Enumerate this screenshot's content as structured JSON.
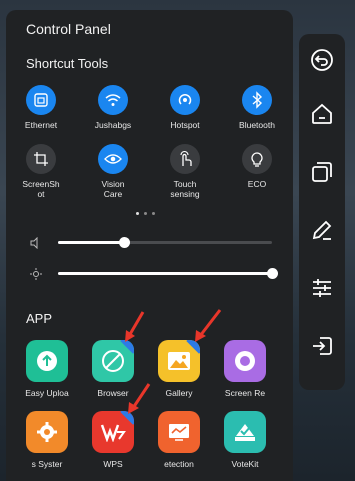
{
  "panel": {
    "title": "Control Panel",
    "shortcut_title": "Shortcut Tools",
    "app_title": "APP"
  },
  "tools": [
    {
      "label": "Ethernet",
      "icon": "ethernet-icon",
      "state": "on"
    },
    {
      "label": "Jushabgs",
      "icon": "wifi-icon",
      "state": "on"
    },
    {
      "label": "Hotspot",
      "icon": "hotspot-icon",
      "state": "on"
    },
    {
      "label": "Bluetooth",
      "icon": "bluetooth-icon",
      "state": "on"
    },
    {
      "label": "ScreenSh\not",
      "icon": "screenshot-crop-icon",
      "state": "off"
    },
    {
      "label": "Vision\nCare",
      "icon": "eye-icon",
      "state": "on"
    },
    {
      "label": "Touch\nsensing",
      "icon": "touch-hand-icon",
      "state": "off"
    },
    {
      "label": "ECO",
      "icon": "bulb-icon",
      "state": "off"
    }
  ],
  "pager": {
    "count": 3,
    "active": 0
  },
  "sliders": [
    {
      "name": "volume",
      "icon": "speaker-icon",
      "value": 0.31
    },
    {
      "name": "brightness",
      "icon": "sun-icon",
      "value": 1.0
    }
  ],
  "apps": [
    {
      "label": "Easy Uploa",
      "icon": "upload-icon",
      "color": "#1fbf96"
    },
    {
      "label": "Browser",
      "icon": "browser-icon",
      "color": "#2fc7a7"
    },
    {
      "label": "Gallery",
      "icon": "gallery-icon",
      "color": "#f5c12a"
    },
    {
      "label": "Screen Re",
      "icon": "screen-record-icon",
      "color": "#a96ce4"
    },
    {
      "label": "s  Syster",
      "icon": "settings-icon",
      "color": "#f28a2a"
    },
    {
      "label": "WPS",
      "icon": "wps-icon",
      "color": "#e8382d"
    },
    {
      "label": "etection",
      "icon": "detection-icon",
      "color": "#f0632e"
    },
    {
      "label": "VoteKit",
      "icon": "votekit-icon",
      "color": "#2bbdb0"
    }
  ],
  "sidebar": [
    "back-icon",
    "home-icon",
    "recent-apps-icon",
    "pen-icon",
    "sliders-icon",
    "input-source-icon"
  ],
  "colors": {
    "accent": "#1a86f0",
    "panel": "#202224",
    "arrow": "#e8362a"
  }
}
